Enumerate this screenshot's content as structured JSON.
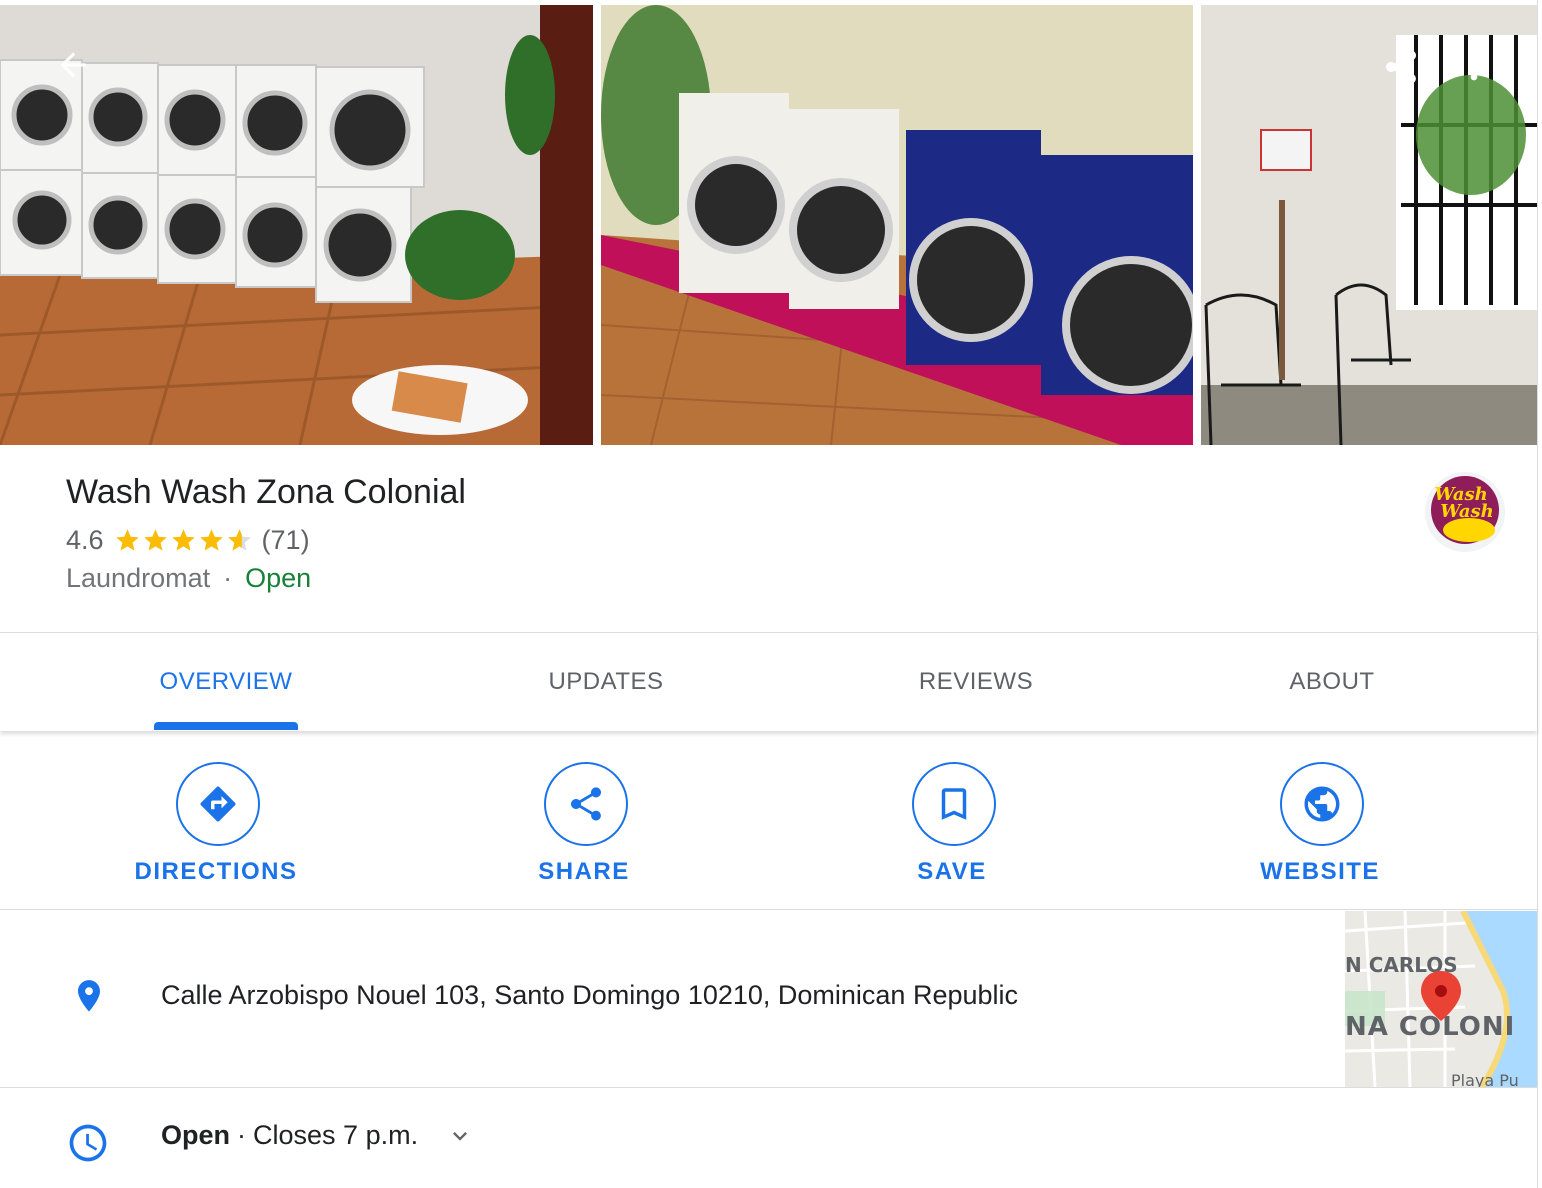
{
  "place": {
    "name": "Wash Wash Zona Colonial",
    "rating": "4.6",
    "rating_value": 4.6,
    "review_count": "(71)",
    "category": "Laundromat",
    "separator": "·",
    "status": "Open",
    "logo_text_top": "Wash",
    "logo_text_bottom": "Wash"
  },
  "colors": {
    "accent": "#1a73e8",
    "open_green": "#188038",
    "star": "#fbbc04",
    "pin_red": "#ea4335"
  },
  "photos": {
    "icons": [
      "back-arrow-icon",
      "share-icon",
      "more-vert-icon"
    ]
  },
  "tabs": [
    {
      "label": "OVERVIEW",
      "active": true
    },
    {
      "label": "UPDATES",
      "active": false
    },
    {
      "label": "REVIEWS",
      "active": false
    },
    {
      "label": "ABOUT",
      "active": false
    }
  ],
  "actions": [
    {
      "label": "DIRECTIONS",
      "icon": "directions-icon"
    },
    {
      "label": "SHARE",
      "icon": "share-icon"
    },
    {
      "label": "SAVE",
      "icon": "bookmark-icon"
    },
    {
      "label": "WEBSITE",
      "icon": "globe-icon"
    }
  ],
  "address": {
    "icon": "location-pin-icon",
    "text": "Calle Arzobispo Nouel 103, Santo Domingo 10210, Dominican Republic"
  },
  "map": {
    "label_top": "N CARLOS",
    "label_mid": "NA COLONI",
    "label_bottom": "Playa Pu"
  },
  "hours": {
    "icon": "clock-icon",
    "status": "Open",
    "separator": "·",
    "closes": "Closes 7 p.m."
  }
}
